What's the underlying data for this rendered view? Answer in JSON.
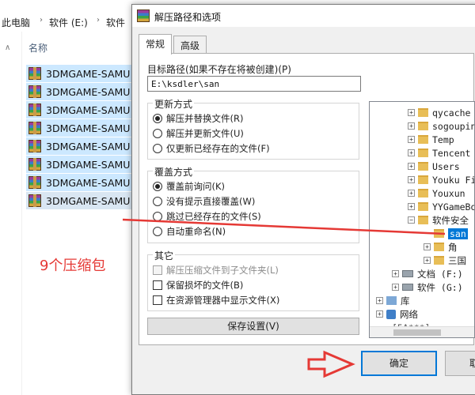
{
  "explorer": {
    "breadcrumb": [
      "此电脑",
      "软件 (E:)",
      "软件"
    ],
    "column_header": "名称",
    "files": [
      "3DMGAME-SAMU",
      "3DMGAME-SAMU",
      "3DMGAME-SAMU",
      "3DMGAME-SAMU",
      "3DMGAME-SAMU",
      "3DMGAME-SAMU",
      "3DMGAME-SAMU",
      "3DMGAME-SAMU"
    ],
    "annotation": "9个压缩包"
  },
  "dialog": {
    "title": "解压路径和选项",
    "tabs": [
      "常规",
      "高级"
    ],
    "path_label": "目标路径(如果不存在将被创建)(P)",
    "path_value": "E:\\ksdler\\san",
    "update_mode": {
      "title": "更新方式",
      "options": [
        "解压并替换文件(R)",
        "解压并更新文件(U)",
        "仅更新已经存在的文件(F)"
      ],
      "selected": 0
    },
    "overwrite_mode": {
      "title": "覆盖方式",
      "options": [
        "覆盖前询问(K)",
        "没有提示直接覆盖(W)",
        "跳过已经存在的文件(S)",
        "自动重命名(N)"
      ],
      "selected": 0
    },
    "misc": {
      "title": "其它",
      "options": [
        "解压压缩文件到子文件夹(L)",
        "保留损坏的文件(B)",
        "在资源管理器中显示文件(X)"
      ]
    },
    "save_settings": "保存设置(V)",
    "tree": [
      "qycache",
      "sogoupin",
      "Temp",
      "Tencent",
      "Users",
      "Youku Fi",
      "Youxun",
      "YYGameBo",
      "软件安全",
      "san",
      "角",
      "三国",
      "文档 (F:)",
      "软件 (G:)",
      "库",
      "网络",
      "[5A***]"
    ],
    "ok": "确定",
    "cancel": "取消"
  },
  "colors": {
    "annotation": "#e53935",
    "selection": "#0078d7"
  }
}
